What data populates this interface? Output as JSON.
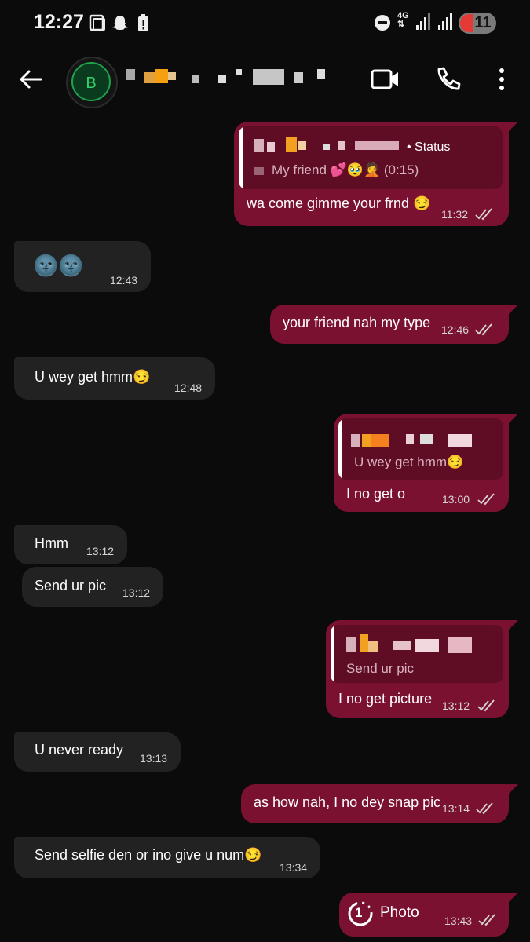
{
  "status_bar": {
    "time": "12:27",
    "network": "4G",
    "battery": "11"
  },
  "header": {
    "avatar_letter": "B"
  },
  "messages": [
    {
      "dir": "out",
      "quote": {
        "label": "Status",
        "text": "My friend 💕🥹🤦 (0:15)"
      },
      "text": "wa come gimme your frnd 😏",
      "time": "11:32"
    },
    {
      "dir": "in",
      "text": "🌚🌚",
      "time": "12:43"
    },
    {
      "dir": "out",
      "text": "your friend nah my type",
      "time": "12:46"
    },
    {
      "dir": "in",
      "text": "U wey get hmm😏",
      "time": "12:48"
    },
    {
      "dir": "out",
      "quote": {
        "text": "U wey get hmm😏"
      },
      "text": "I no get o",
      "time": "13:00"
    },
    {
      "dir": "in",
      "text": "Hmm",
      "time": "13:12"
    },
    {
      "dir": "in",
      "text": "Send ur pic",
      "time": "13:12"
    },
    {
      "dir": "out",
      "quote": {
        "text": "Send ur pic"
      },
      "text": "I no get picture",
      "time": "13:12"
    },
    {
      "dir": "in",
      "text": "U never ready",
      "time": "13:13"
    },
    {
      "dir": "out",
      "text": "as how nah, I no dey snap pic",
      "time": "13:14"
    },
    {
      "dir": "in",
      "text": "Send selfie den or ino give u num😏",
      "time": "13:34"
    },
    {
      "dir": "out",
      "text": "Photo",
      "view_once": "1",
      "time": "13:43"
    }
  ],
  "colors": {
    "background": "#0b0b0b",
    "incoming_bubble": "#222222",
    "outgoing_bubble": "#7b1130",
    "quote_bg": "#5e0d25",
    "avatar_ring": "#1ea34c"
  }
}
